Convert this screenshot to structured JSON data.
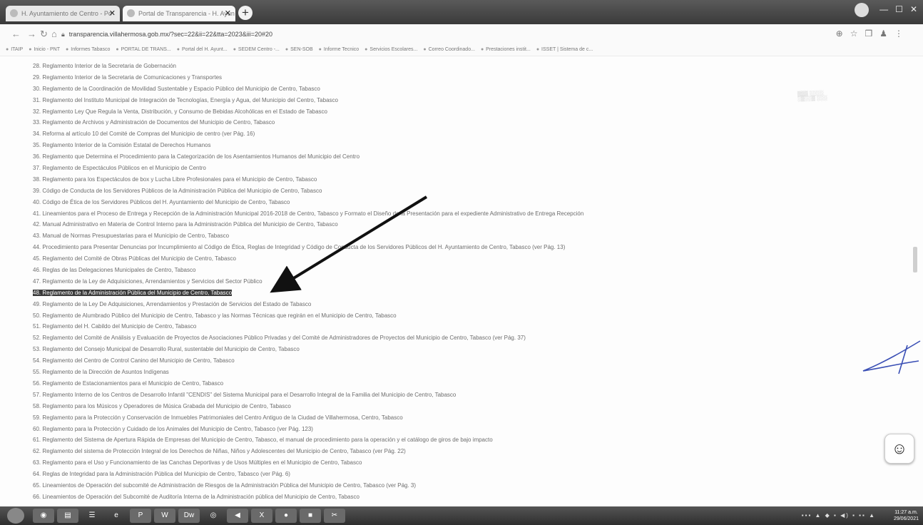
{
  "browser": {
    "tabs": [
      {
        "label": "H. Ayuntamiento de Centro - Po"
      },
      {
        "label": "Portal de Transparencia - H. Ayun"
      }
    ],
    "url": "transparencia.villahermosa.gob.mx/?sec=22&ii=22&tta=2023&iii=20#20",
    "bookmarks": [
      "ITAIP",
      "Inicio - PNT",
      "Informes Tabasco",
      "PORTAL DE TRANS...",
      "Portal del H. Ayunt...",
      "SEDEM Centro -...",
      "SEN-SOB",
      "Informe Tecnico",
      "Servicios Escolares...",
      "Correo Coordinado...",
      "Prestaciones instit...",
      "ISSET | Sistema de c..."
    ]
  },
  "list": {
    "items": [
      "28. Reglamento Interior de la Secretaria de Gobernación",
      "29. Reglamento Interior de la Secretaria de Comunicaciones y Transportes",
      "30. Reglamento de la Coordinación de Movilidad Sustentable y Espacio Público del Municipio de Centro, Tabasco",
      "31. Reglamento del Instituto Municipal de Integración de Tecnologías, Energía y Agua, del Municipio del Centro, Tabasco",
      "32. Reglamento Ley Que Regula la Venta, Distribución, y Consumo de Bebidas Alcohólicas en el Estado de Tabasco",
      "33. Reglamento de Archivos y Administración de Documentos del Municipio de Centro, Tabasco",
      "34. Reforma al artículo 10 del Comité de Compras del Municipio de centro (ver Pág. 16)",
      "35. Reglamento Interior de la Comisión Estatal de Derechos Humanos",
      "36. Reglamento que Determina el Procedimiento para la Categorización de los Asentamientos Humanos del Municipio del Centro",
      "37. Reglamento de Espectáculos Públicos en el Municipio de Centro",
      "38. Reglamento para los Espectáculos de box y Lucha Libre Profesionales para el Municipio de Centro, Tabasco",
      "39. Código de Conducta de los Servidores Públicos de la Administración Pública del Municipio de Centro, Tabasco",
      "40. Código de Ética de los Servidores Públicos del H. Ayuntamiento del Municipio de Centro, Tabasco",
      "41. Lineamientos para el Proceso de Entrega y Recepción de la Administración Municipal 2016-2018 de Centro, Tabasco y Formato el Diseño de la Presentación para el expediente Administrativo de Entrega Recepción",
      "42. Manual Administrativo en Materia de Control Interno para la Administración Pública del Municipio de Centro, Tabasco",
      "43. Manual de Normas Presupuestarias para el Municipio de Centro, Tabasco",
      "44. Procedimiento para Presentar Denuncias por Incumplimiento al Código de Ética, Reglas de Integridad y Código de Conducta de los Servidores Públicos del H. Ayuntamiento de Centro, Tabasco (ver Pág. 13)",
      "45. Reglamento del Comité de Obras Públicas del Municipio de Centro, Tabasco",
      "46. Reglas de las Delegaciones Municipales de Centro, Tabasco",
      "47. Reglamento de la Ley de Adquisiciones, Arrendamientos y Servicios del Sector Público",
      "48. Reglamento de la Administración Pública del Municipio de Centro, Tabasco",
      "49. Reglamento de la Ley De Adquisiciones, Arrendamientos y Prestación de Servicios del Estado de Tabasco",
      "50. Reglamento de Alumbrado Público del Municipio de Centro, Tabasco y las Normas Técnicas que regirán en el Municipio de Centro, Tabasco",
      "51. Reglamento del H. Cabildo del Municipio de Centro, Tabasco",
      "52. Reglamento del Comité de Análisis y Evaluación de Proyectos de Asociaciones Público Privadas y del Comité de Administradores de Proyectos del Municipio de Centro, Tabasco (ver Pág. 37)",
      "53. Reglamento del Consejo Municipal de Desarrollo Rural, sustentable del Municipio de Centro, Tabasco",
      "54. Reglamento del Centro de Control Canino del Municipio de Centro, Tabasco",
      "55. Reglamento de la Dirección de Asuntos Indígenas",
      "56. Reglamento de Estacionamientos para el Municipio de Centro, Tabasco",
      "57. Reglamento Interno de los Centros de Desarrollo Infantil \"CENDIS\" del Sistema Municipal para el Desarrollo Integral de la Familia del Municipio de Centro, Tabasco",
      "58. Reglamento para los Músicos y Operadores de Música Grabada del Municipio de Centro, Tabasco",
      "59. Reglamento para la Protección y Conservación de Inmuebles Patrimoniales del Centro Antiguo de la Ciudad de Villahermosa, Centro, Tabasco",
      "60. Reglamento para la Protección y Cuidado de los Animales del Municipio de Centro, Tabasco (ver Pág. 123)",
      "61. Reglamento del Sistema de Apertura Rápida de Empresas del Municipio de Centro, Tabasco, el manual de procedimiento para la operación y el catálogo de giros de bajo impacto",
      "62. Reglamento del sistema de Protección Integral de los Derechos de Niñas, Niños y Adolescentes del Municipio de Centro, Tabasco (ver Pág. 22)",
      "63. Reglamento para el Uso y Funcionamiento de las Canchas Deportivas y de Usos Múltiples en el Municipio de Centro, Tabasco",
      "64. Reglas de Integridad para la Administración Pública del Municipio de Centro, Tabasco (ver Pág. 6)",
      "65. Lineamientos de Operación del subcomité de Administración de Riesgos de la Administración Pública del Municipio de Centro, Tabasco (ver Pág. 3)",
      "66. Lineamientos de Operación del Subcomité de Auditoría Interna de la Administración pública del Municipio de Centro, Tabasco"
    ],
    "highlighted_index": 20
  },
  "taskbar": {
    "clock_time": "11:27 a.m.",
    "clock_date": "29/06/2021"
  }
}
